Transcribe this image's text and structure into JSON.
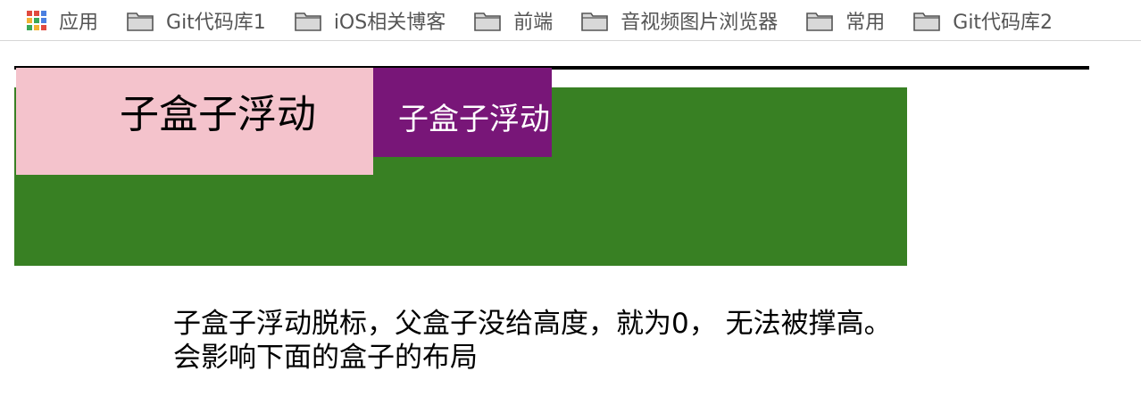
{
  "bookmarks": {
    "apps_label": "应用",
    "folders": [
      "Git代码库1",
      "iOS相关博客",
      "前端",
      "音视频图片浏览器",
      "常用",
      "Git代码库2"
    ]
  },
  "demo": {
    "pink_label": "子盒子浮动",
    "purple_label": "子盒子浮动"
  },
  "caption": {
    "line1": "子盒子浮动脱标，父盒子没给高度，就为0， 无法被撑高。",
    "line2": "会影响下面的盒子的布局"
  },
  "colors": {
    "green": "#388023",
    "pink": "#f4c3cc",
    "purple": "#781678"
  }
}
